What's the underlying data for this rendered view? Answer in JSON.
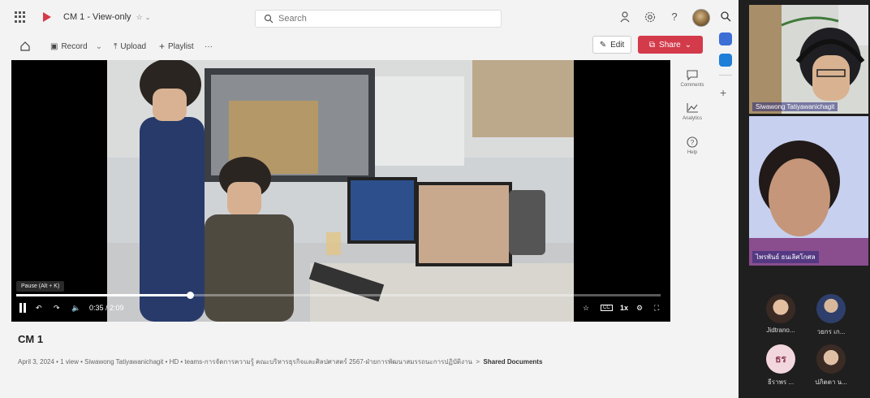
{
  "header": {
    "title": "CM 1 - View-only",
    "search_placeholder": "Search"
  },
  "commands": {
    "record": "Record",
    "upload": "Upload",
    "playlist": "Playlist",
    "more": "···",
    "edit": "Edit",
    "share": "Share"
  },
  "rail": {
    "comments": "Comments",
    "analytics": "Analytics",
    "help": "Help"
  },
  "player": {
    "tooltip": "Pause (Alt + K)",
    "time": "0:35 / 2:09",
    "speed": "1x",
    "progress_fraction": 0.27
  },
  "video": {
    "title": "CM 1",
    "date": "April 3, 2024",
    "views": "1 view",
    "owner": "Siwawong Tatiyawanichagit",
    "quality": "HD",
    "path": "teams-การจัดการความรู้ คณะบริหารธุรกิจและศิลปศาสตร์ 2567-ฝ่ายการพัฒนาสมรรถนะการปฏิบัติงาน",
    "location": "Shared Documents"
  },
  "participants": {
    "main": "Siwawong Tatiyawanichagit",
    "second": "ไพรพันธ์ ธนเลิศโกศล",
    "small": [
      {
        "name": "Jidtrano..."
      },
      {
        "name": "วยกร เก..."
      },
      {
        "name": "ธีราพร ...",
        "initials": "ธร"
      },
      {
        "name": "ปภิตตา น..."
      }
    ]
  },
  "colors": {
    "share": "#d33a4a",
    "stream_bg": "#f3f3f3",
    "teams_bg": "#1f1f1f"
  }
}
